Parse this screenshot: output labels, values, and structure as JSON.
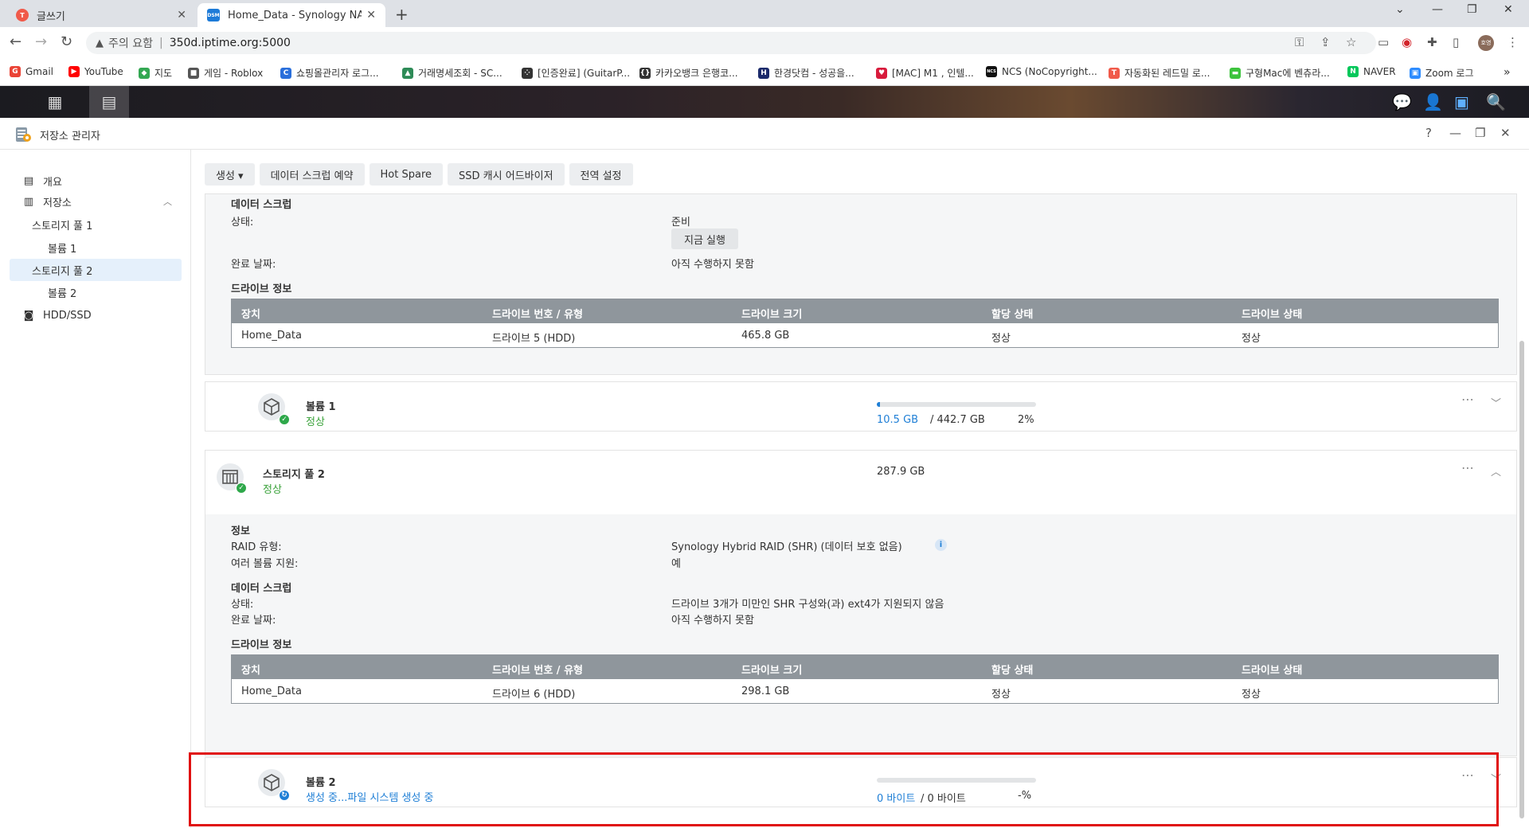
{
  "browser": {
    "tabs": [
      {
        "title": "글쓰기",
        "favicon": "T"
      },
      {
        "title": "Home_Data - Synology NAS",
        "favicon": "DSM"
      }
    ],
    "new_tab": "+",
    "security_label": "주의 요함",
    "url": "350d.iptime.org:5000",
    "avatar": "호영",
    "bookmarks": [
      {
        "label": "Gmail",
        "icon": "G",
        "color": "#ea4335"
      },
      {
        "label": "YouTube",
        "icon": "▶",
        "color": "#ff0000"
      },
      {
        "label": "지도",
        "icon": "◆",
        "color": "#34a853"
      },
      {
        "label": "게임 - Roblox",
        "icon": "■",
        "color": "#555555"
      },
      {
        "label": "쇼핑몰관리자 로그...",
        "icon": "C",
        "color": "#2a6fdb"
      },
      {
        "label": "거래명세조회 - SC...",
        "icon": "▲",
        "color": "#2e8b57"
      },
      {
        "label": "[인증완료] (GuitarP...",
        "icon": "⁘",
        "color": "#333333"
      },
      {
        "label": "카카오뱅크 은행코...",
        "icon": "{}",
        "color": "#333333"
      },
      {
        "label": "한경닷컴 - 성공을...",
        "icon": "H",
        "color": "#1b2a6b"
      },
      {
        "label": "[MAC] M1 , 인텔...",
        "icon": "♥",
        "color": "#d81b3c"
      },
      {
        "label": "NCS (NoCopyright...",
        "icon": "NCS",
        "color": "#111111"
      },
      {
        "label": "자동화된 레드밀 로...",
        "icon": "T",
        "color": "#f05a4a"
      },
      {
        "label": "구형Mac에 벤츄라...",
        "icon": "▬",
        "color": "#3cc33c"
      },
      {
        "label": "NAVER",
        "icon": "N",
        "color": "#03c75a"
      },
      {
        "label": "Zoom 로그",
        "icon": "▣",
        "color": "#2d8cff"
      }
    ],
    "bookmarks_more": "»"
  },
  "app": {
    "title": "저장소 관리자",
    "help": "?",
    "sidebar": [
      {
        "label": "개요",
        "level": 0
      },
      {
        "label": "저장소",
        "level": 0
      },
      {
        "label": "스토리지 풀 1",
        "level": 1
      },
      {
        "label": "볼륨 1",
        "level": 2
      },
      {
        "label": "스토리지 풀 2",
        "level": 1,
        "selected": true
      },
      {
        "label": "볼륨 2",
        "level": 2
      },
      {
        "label": "HDD/SSD",
        "level": 0
      }
    ],
    "toolbar": [
      "생성 ▾",
      "데이터 스크럽 예약",
      "Hot Spare",
      "SSD 캐시 어드바이저",
      "전역 설정"
    ]
  },
  "pool1_detail": {
    "scrub_header": "데이터 스크럽",
    "status_label": "상태:",
    "status_value": "준비",
    "run_now": "지금 실행",
    "done_label": "완료 날짜:",
    "done_value": "아직 수행하지 못함",
    "drive_header": "드라이브 정보",
    "columns": [
      "장치",
      "드라이브 번호 / 유형",
      "드라이브 크기",
      "할당 상태",
      "드라이브 상태"
    ],
    "row": [
      "Home_Data",
      "드라이브 5 (HDD)",
      "465.8 GB",
      "정상",
      "정상"
    ]
  },
  "volume1": {
    "name": "볼륨 1",
    "status": "정상",
    "used": "10.5 GB",
    "total": " / 442.7 GB",
    "percent": "2%",
    "fill": 0.02
  },
  "pool2": {
    "name": "스토리지 풀 2",
    "status": "정상",
    "size": "287.9 GB",
    "info_header": "정보",
    "raid_label": "RAID 유형:",
    "raid_value": "Synology Hybrid RAID (SHR) (데이터 보호 없음)",
    "multi_label": "여러 볼륨 지원:",
    "multi_value": "예",
    "scrub_header": "데이터 스크럽",
    "status_label": "상태:",
    "scrub_status": "드라이브 3개가 미만인 SHR 구성와(과) ext4가 지원되지 않음",
    "done_label": "완료 날짜:",
    "done_value": "아직 수행하지 못함",
    "drive_header": "드라이브 정보",
    "columns": [
      "장치",
      "드라이브 번호 / 유형",
      "드라이브 크기",
      "할당 상태",
      "드라이브 상태"
    ],
    "row": [
      "Home_Data",
      "드라이브 6 (HDD)",
      "298.1 GB",
      "정상",
      "정상"
    ]
  },
  "volume2": {
    "name": "볼륨 2",
    "status": "생성 중...파일 시스템 생성 중",
    "used": "0 바이트",
    "total": " / 0 바이트",
    "percent": "-%",
    "fill": 0
  },
  "colors": {
    "ok": "#3aa23a",
    "accent": "#1f7fd6",
    "highlight": "#e01010"
  }
}
